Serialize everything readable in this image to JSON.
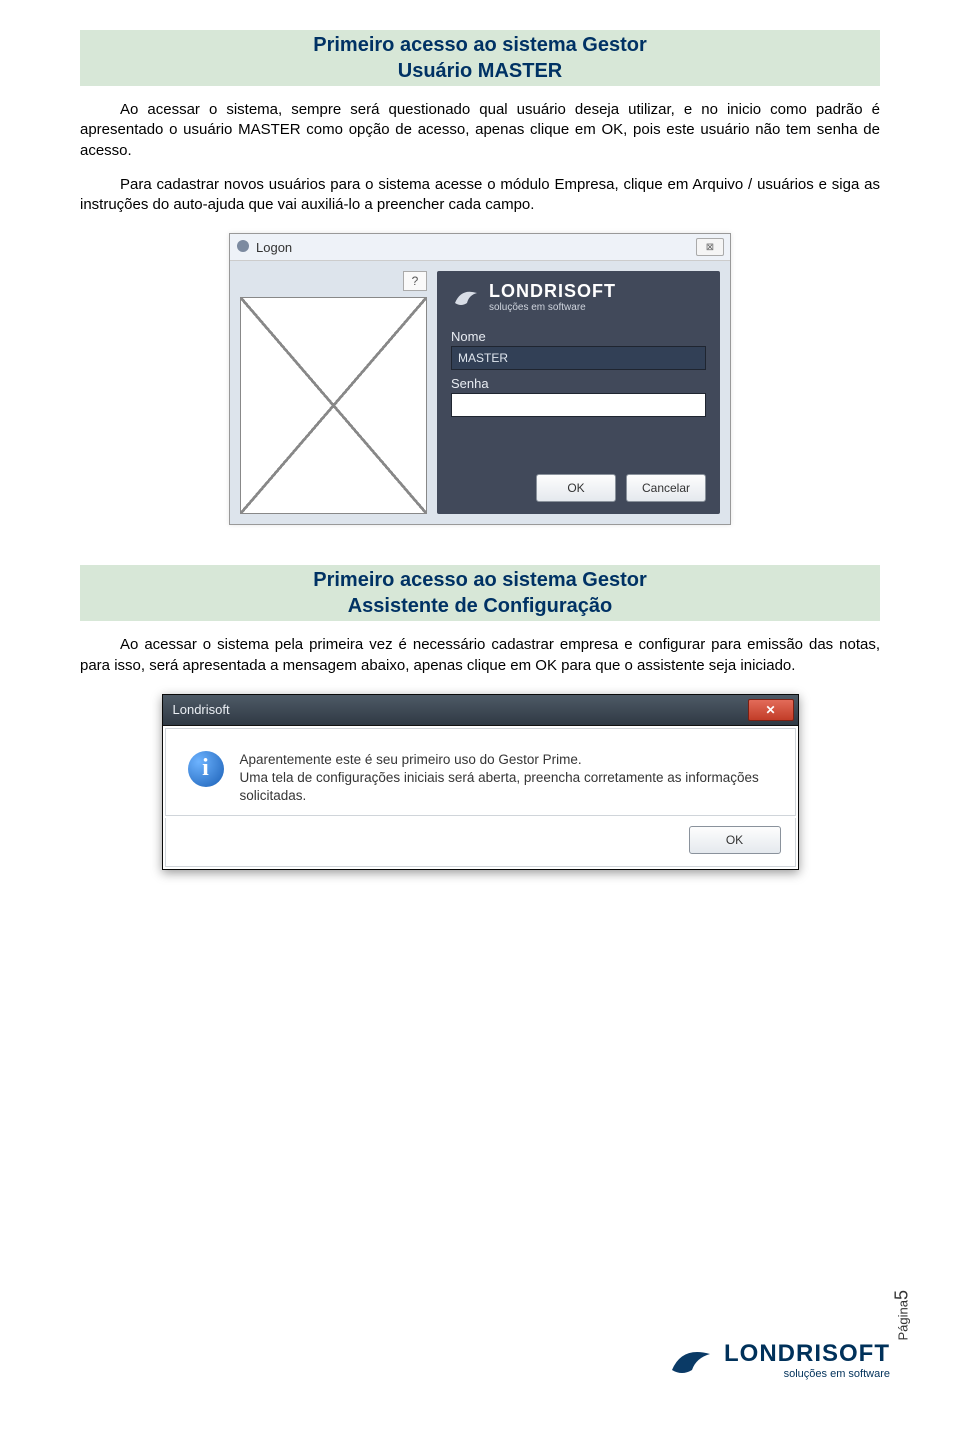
{
  "section1": {
    "title_line1": "Primeiro acesso ao sistema Gestor",
    "title_line2": "Usuário MASTER",
    "para1": "Ao acessar o sistema, sempre será questionado qual usuário deseja utilizar, e no inicio como padrão é apresentado o usuário MASTER como opção de acesso, apenas clique em OK, pois este usuário não tem senha de acesso.",
    "para2": "Para cadastrar novos usuários para o sistema acesse o módulo Empresa, clique em Arquivo / usuários e siga as instruções do auto-ajuda que vai auxiliá-lo a preencher cada campo."
  },
  "logon_dialog": {
    "window_title": "Logon",
    "close_glyph": "⊠",
    "help_glyph": "?",
    "brand_name": "LONDRISOFT",
    "brand_tag": "soluções em software",
    "label_nome": "Nome",
    "value_nome": "MASTER",
    "label_senha": "Senha",
    "value_senha": "",
    "btn_ok": "OK",
    "btn_cancel": "Cancelar"
  },
  "section2": {
    "title_line1": "Primeiro acesso ao sistema Gestor",
    "title_line2": "Assistente de Configuração",
    "para1": "Ao acessar o sistema pela primeira vez é necessário cadastrar empresa e configurar para emissão das notas, para isso, será apresentada a mensagem abaixo, apenas clique em OK para que o assistente seja iniciado."
  },
  "msgbox": {
    "window_title": "Londrisoft",
    "close_glyph": "✕",
    "info_glyph": "i",
    "line1": "Aparentemente este é seu primeiro uso do Gestor Prime.",
    "line2": "Uma tela de configurações iniciais será aberta, preencha corretamente as informações solicitadas.",
    "btn_ok": "OK"
  },
  "footer": {
    "page_label": "Página",
    "page_number": "5",
    "brand_name": "LONDRISOFT",
    "brand_tag": "soluções em software"
  }
}
